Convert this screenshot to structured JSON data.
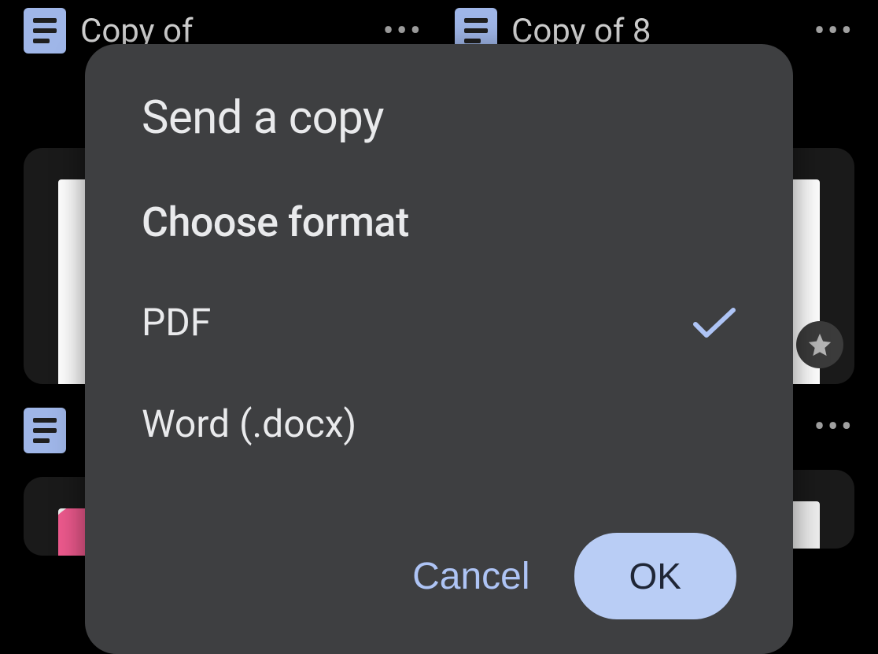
{
  "background": {
    "cards": [
      {
        "title": "Copy of"
      },
      {
        "title": "Copy of 8"
      }
    ]
  },
  "modal": {
    "title": "Send a copy",
    "subtitle": "Choose format",
    "options": [
      {
        "label": "PDF",
        "selected": true
      },
      {
        "label": "Word (.docx)",
        "selected": false
      }
    ],
    "actions": {
      "cancel": "Cancel",
      "ok": "OK"
    }
  }
}
